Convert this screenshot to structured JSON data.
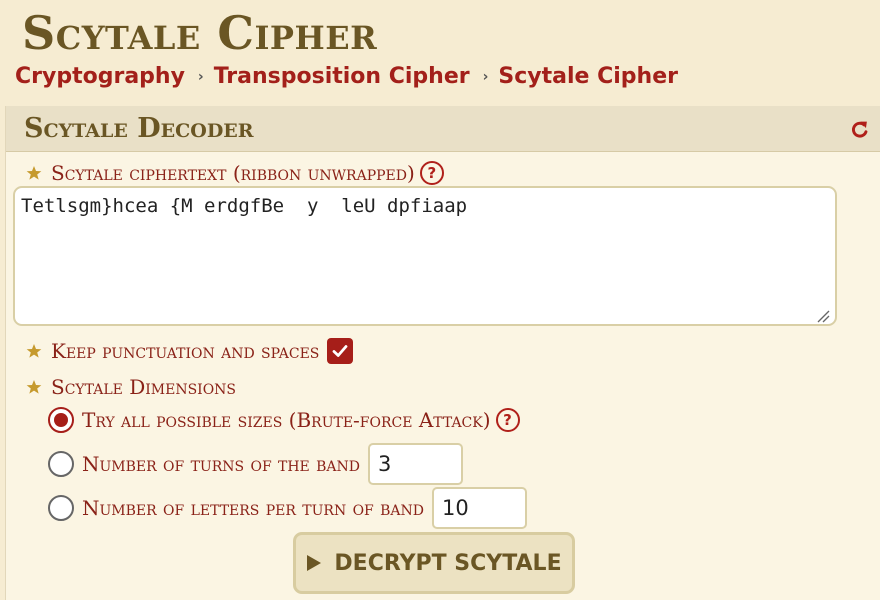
{
  "page": {
    "title": "Scytale Cipher"
  },
  "breadcrumb": [
    {
      "label": "Cryptography"
    },
    {
      "label": "Transposition Cipher"
    },
    {
      "label": "Scytale Cipher"
    }
  ],
  "breadcrumb_separator": "›",
  "tool": {
    "title": "Scytale Decoder",
    "reset_icon": "reset-arrow-icon",
    "ciphertext": {
      "label": "Scytale ciphertext (ribbon unwrapped)",
      "help": "?",
      "value": "Tetlsgm}hcea {M erdgfBe  y  leU dpfiaap"
    },
    "keep_punct": {
      "label": "Keep punctuation and spaces",
      "checked": true
    },
    "dimensions": {
      "label": "Scytale Dimensions",
      "options": [
        {
          "label": "Try all possible sizes (Brute-force Attack)",
          "checked": true,
          "help": "?"
        },
        {
          "label": "Number of turns of the band",
          "checked": false,
          "value": "3"
        },
        {
          "label": "Number of letters per turn of band",
          "checked": false,
          "value": "10"
        }
      ]
    },
    "decrypt_button": {
      "label": "DECRYPT SCYTALE",
      "icon": "play-icon"
    }
  },
  "colors": {
    "background": "#f6ecd2",
    "title": "#6a5624",
    "accent_red": "#a61e19",
    "header_band": "#e9e0c7"
  }
}
